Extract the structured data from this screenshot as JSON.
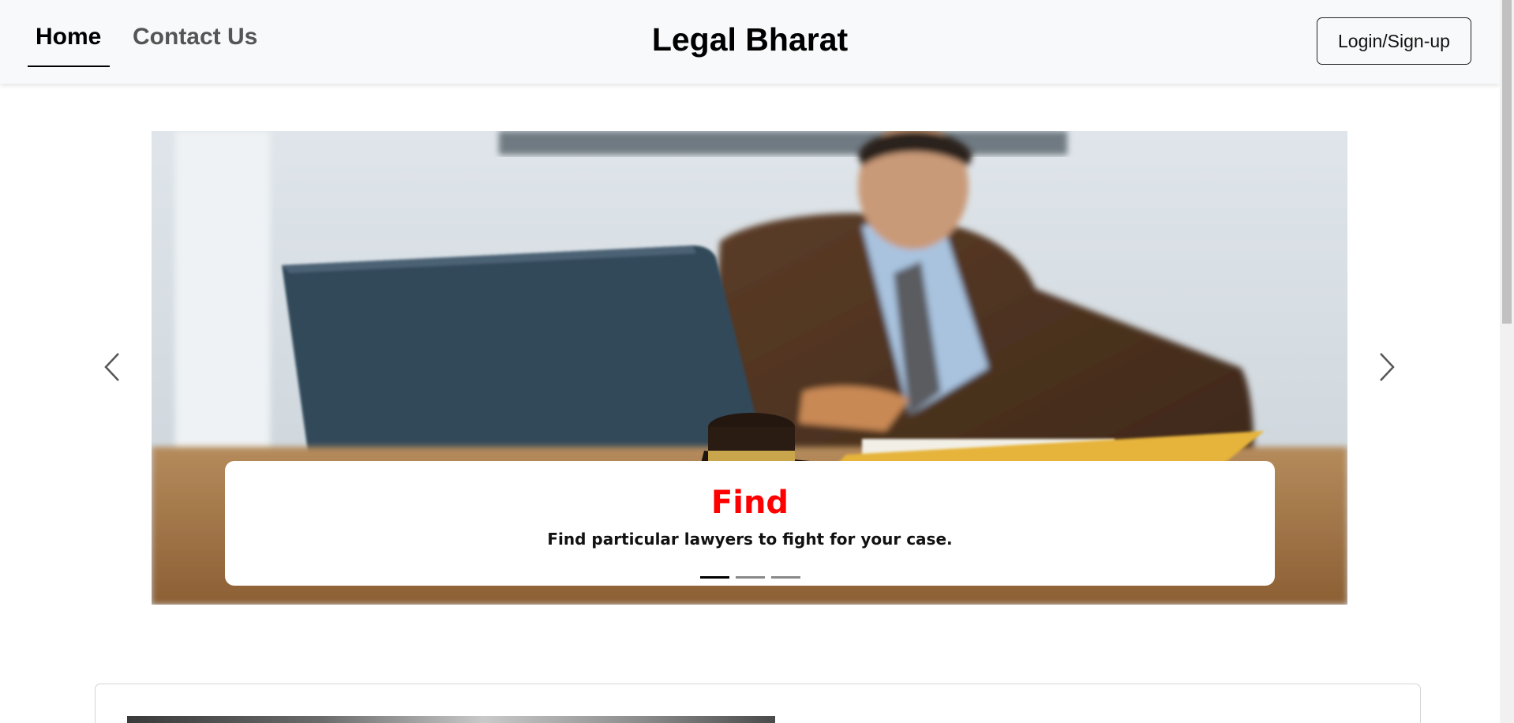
{
  "navbar": {
    "links": [
      {
        "label": "Home",
        "active": true
      },
      {
        "label": "Contact Us",
        "active": false
      }
    ],
    "brand": "Legal Bharat",
    "login_label": "Login/Sign-up"
  },
  "carousel": {
    "slide": {
      "title": "Find",
      "text": "Find particular lawyers to fight for your case.",
      "image": "lawyer-at-laptop-with-gavel"
    },
    "indicators": [
      true,
      false,
      false
    ],
    "prev_icon": "chevron-left-icon",
    "next_icon": "chevron-right-icon"
  },
  "colors": {
    "caption_title": "#ff0000",
    "navbar_bg": "#f8f9fa",
    "active_indicator": "#000000",
    "inactive_indicator": "#888888"
  }
}
